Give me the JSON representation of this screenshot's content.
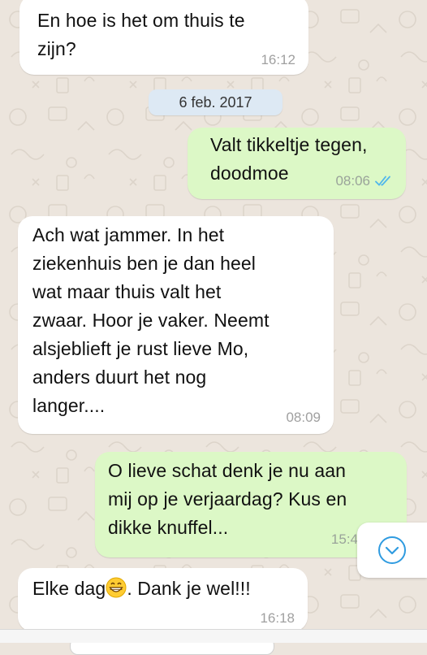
{
  "date_separator": "6 feb. 2017",
  "messages": [
    {
      "dir": "in",
      "text_lines": [
        "En hoe is het om thuis te",
        "zijn?"
      ],
      "time": "16:12"
    },
    {
      "dir": "out",
      "text_lines": [
        "Valt tikkeltje tegen,",
        "doodmoe"
      ],
      "time": "08:06",
      "status": "read"
    },
    {
      "dir": "in",
      "text_lines": [
        "Ach wat jammer. In het",
        "ziekenhuis ben je dan heel",
        "wat maar thuis valt het",
        "zwaar. Hoor je vaker. Neemt",
        "alsjeblieft je rust lieve Mo,",
        "anders duurt het nog",
        "langer...."
      ],
      "time": "08:09"
    },
    {
      "dir": "out",
      "text_lines": [
        "O lieve schat denk je nu aan",
        "mij op je verjaardag? Kus en",
        "dikke knuffel..."
      ],
      "time": "15:4"
    },
    {
      "dir": "in",
      "text_before_emoji": "Elke dag",
      "emoji": "grinning-face",
      "text_after_emoji": ". Dank je wel!!!",
      "time": "16:18"
    }
  ],
  "icons": {
    "read_receipt": "double-check-icon",
    "scroll_down": "chevron-down-icon"
  },
  "colors": {
    "background": "#ECE5DD",
    "incoming_bubble": "#FFFFFF",
    "outgoing_bubble": "#DCF8C6",
    "read_tick": "#4FB6EC",
    "date_pill": "#DDE9F4",
    "scroll_button_icon": "#2F9BE0"
  }
}
